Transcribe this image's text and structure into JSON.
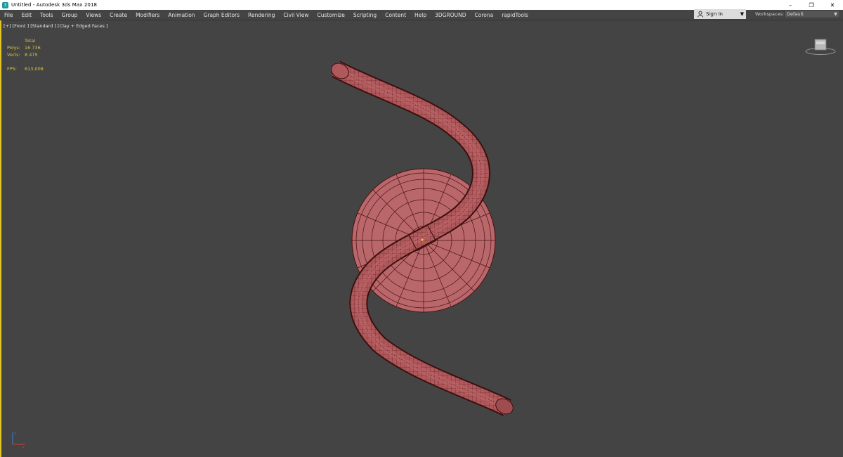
{
  "window": {
    "title": "Untitled - Autodesk 3ds Max 2018",
    "app_icon": "3ds-max-icon",
    "controls": {
      "minimize": "–",
      "restore": "❐",
      "close": "✕"
    }
  },
  "menu": [
    "File",
    "Edit",
    "Tools",
    "Group",
    "Views",
    "Create",
    "Modifiers",
    "Animation",
    "Graph Editors",
    "Rendering",
    "Civil View",
    "Customize",
    "Scripting",
    "Content",
    "Help",
    "3DGROUND",
    "Corona",
    "rapidTools"
  ],
  "account": {
    "sign_in": "Sign In",
    "dropdown": "▼"
  },
  "workspaces": {
    "label": "Workspaces:",
    "value": "Default",
    "dropdown": "▼"
  },
  "viewport": {
    "label": "[+] [Front ] [Standard ] [Clay + Edged Faces ]",
    "stats": {
      "header": "Total",
      "polys_label": "Polys:",
      "polys_value": "16 736",
      "verts_label": "Verts:",
      "verts_value": "8 475",
      "fps_label": "FPS:",
      "fps_value": "613,008"
    },
    "colors": {
      "background": "#444444",
      "mesh_fill": "#b0595d",
      "mesh_edge": "#4a1412",
      "active_border": "#e2c628"
    }
  }
}
